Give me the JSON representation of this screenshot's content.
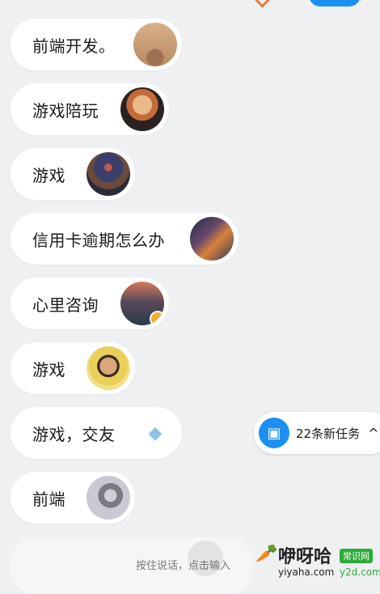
{
  "topics": [
    {
      "label": "前端开发。",
      "avatar": "desert-figure-avatar"
    },
    {
      "label": "游戏陪玩",
      "avatar": "red-hair-boy-avatar"
    },
    {
      "label": "游戏",
      "avatar": "night-tree-avatar"
    },
    {
      "label": "信用卡逾期怎么办",
      "avatar": "city-night-avatar"
    },
    {
      "label": "心里咨询",
      "avatar": "sunset-city-avatar"
    },
    {
      "label": "游戏",
      "avatar": "man-yellow-avatar"
    },
    {
      "label": "游戏，交友",
      "avatar": "whale-icon"
    },
    {
      "label": "前端",
      "avatar": "anime-girl-avatar"
    }
  ],
  "tasks": {
    "label": "22条新任务",
    "chevron": "^",
    "icon": "task-user-icon"
  },
  "bottom": {
    "hint": "按住说话，点击输入"
  },
  "watermark": {
    "carrot": "🥕",
    "title": "咿呀哈",
    "badge": "常识网",
    "domain": "yiyaha.com",
    "domain2": "y2d.com"
  },
  "colors": {
    "accent": "#1e8ff2",
    "background": "#eff0f2",
    "chip": "#ffffff",
    "brand_green": "#2eaa3a"
  }
}
